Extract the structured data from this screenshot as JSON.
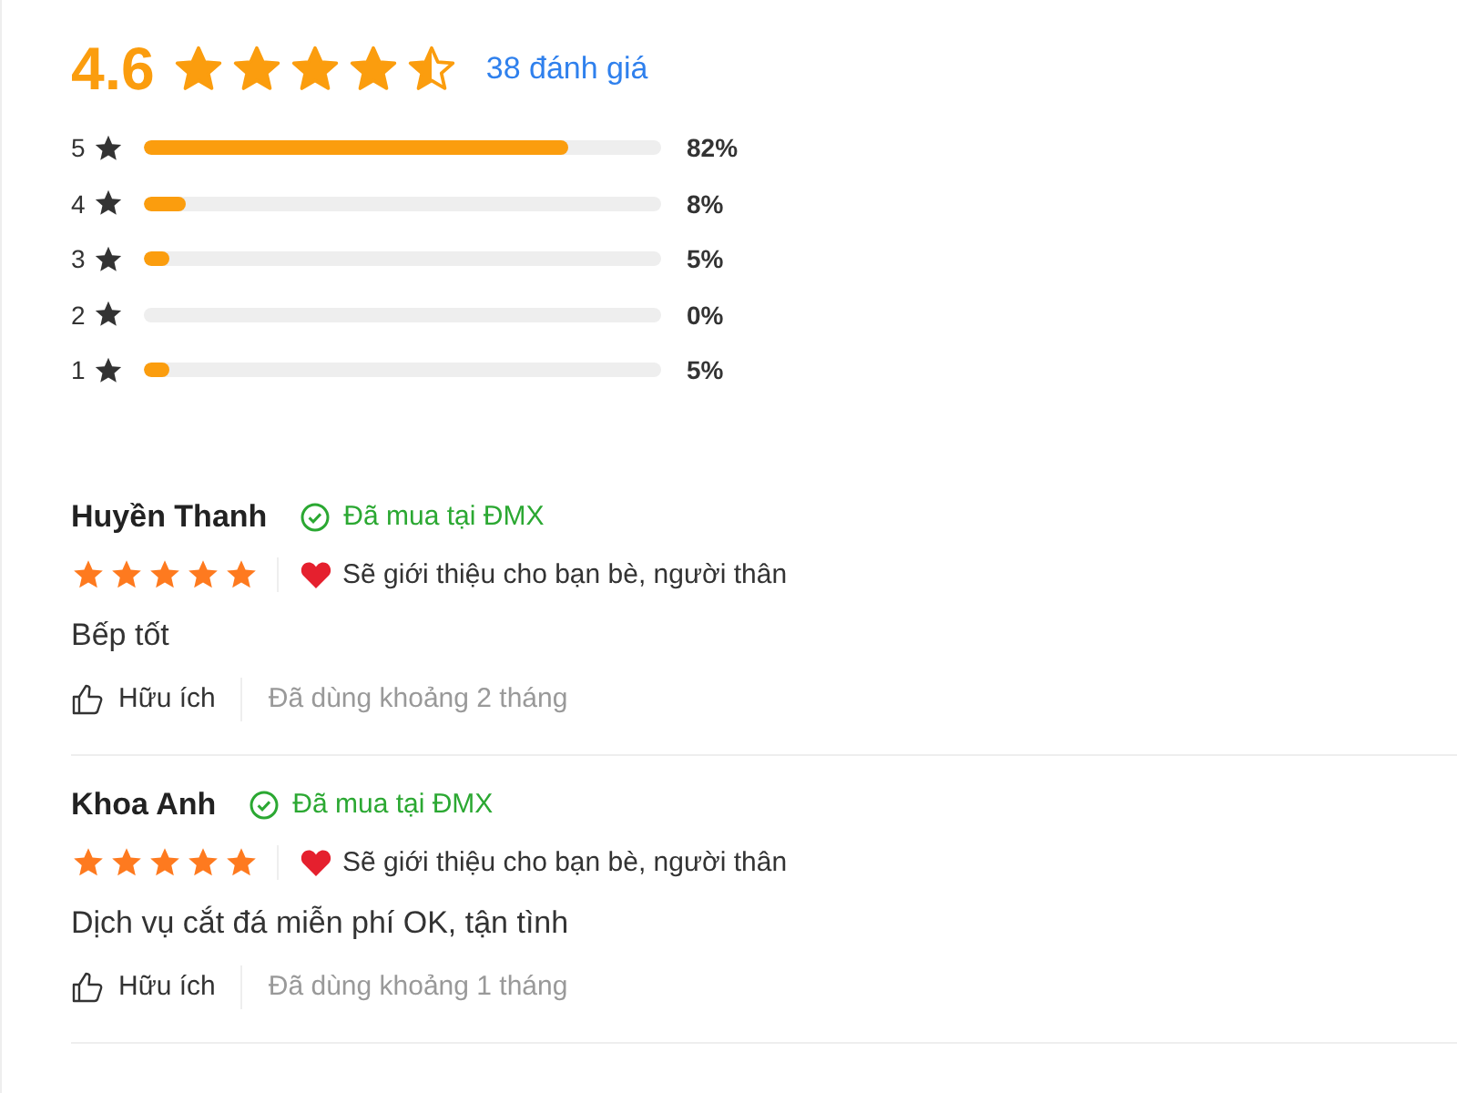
{
  "summary": {
    "score": "4.6",
    "stars": 4.5,
    "count": "38 đánh giá"
  },
  "distribution": [
    {
      "label": "5",
      "level": 0.82,
      "percent": "82%"
    },
    {
      "label": "4",
      "level": 0.08,
      "percent": "8%"
    },
    {
      "label": "3",
      "level": 0.05,
      "percent": "5%"
    },
    {
      "label": "2",
      "level": 0,
      "percent": "0%"
    },
    {
      "label": "1",
      "level": 0.05,
      "percent": "5%"
    }
  ],
  "reviews": [
    {
      "name": "Huyền Thanh",
      "verified": "Đã mua tại ĐMX",
      "stars": 5,
      "recommend": "Sẽ giới thiệu cho bạn bè, người thân",
      "text": "Bếp tốt",
      "helpful": "Hữu ích",
      "usage": "Đã dùng khoảng 2 tháng"
    },
    {
      "name": "Khoa Anh",
      "verified": "Đã mua tại ĐMX",
      "stars": 5,
      "recommend": "Sẽ giới thiệu cho bạn bè, người thân",
      "text": "Dịch vụ cắt đá miễn phí OK, tận tình",
      "helpful": "Hữu ích",
      "usage": "Đã dùng khoảng 1 tháng"
    }
  ]
}
